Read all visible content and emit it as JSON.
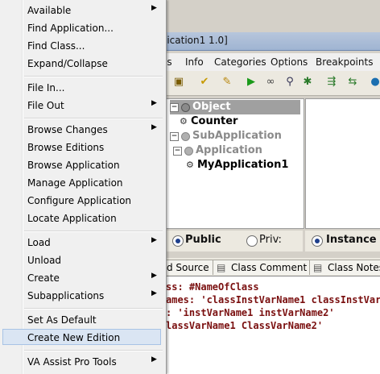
{
  "window": {
    "title": "lication1 1.0]",
    "menubar": [
      "es",
      "Info",
      "Categories",
      "Options",
      "Breakpoints"
    ]
  },
  "tree": {
    "items": [
      {
        "label": "Object",
        "selected": true
      },
      {
        "label": "Counter"
      },
      {
        "label": "SubApplication"
      },
      {
        "label": "Application"
      },
      {
        "label": "MyApplication1"
      }
    ]
  },
  "radios": {
    "public": "Public",
    "private": "Priv:",
    "instance": "Instance"
  },
  "tabs": [
    "d Source",
    "Class Comment",
    "Class Notes"
  ],
  "code_lines": [
    "ss: #NameOfClass",
    "ames: 'classInstVarName1 classInstVarN",
    ": 'instVarName1 instVarName2'",
    "lassVarName1 ClassVarName2'"
  ],
  "menu": {
    "available": "Available",
    "find_application": "Find Application...",
    "find_class": "Find Class...",
    "expand_collapse": "Expand/Collapse",
    "file_in": "File In...",
    "file_out": "File Out",
    "browse_changes": "Browse Changes",
    "browse_editions": "Browse Editions",
    "browse_application": "Browse Application",
    "manage_application": "Manage Application",
    "configure_application": "Configure Application",
    "locate_application": "Locate Application",
    "load": "Load",
    "unload": "Unload",
    "create": "Create",
    "subapplications": "Subapplications",
    "set_as_default": "Set As Default",
    "create_new_edition": "Create New Edition",
    "va_assist_pro_tools": "VA Assist Pro Tools"
  },
  "colors": {
    "highlight": "#dae5f3",
    "code_text": "#7a0f0f"
  }
}
